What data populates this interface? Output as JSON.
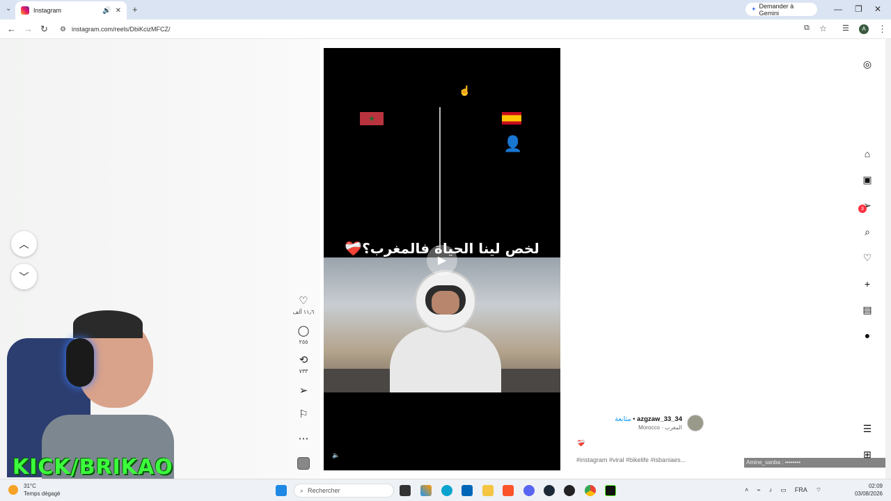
{
  "browser": {
    "tab_title": "Instagram",
    "tab_audio_icon": "speaker-icon",
    "tab_close": "✕",
    "new_tab": "+",
    "gemini_label": "Demander à Gemini",
    "url": "instagram.com/reels/DbiKcizMFCZ/",
    "window_controls": [
      "—",
      "❐",
      "✕"
    ]
  },
  "left": {
    "prev_label": "︿",
    "next_label": "﹀",
    "webcam_overlay_text": "KICK/BRIKAO"
  },
  "actions": {
    "like_count": "١١٫٦ ألف",
    "comment_count": "٢٥٥",
    "repost_count": "٧٣٣"
  },
  "video": {
    "caption": "لخص لينا الحياة فالمغرب؟❤️‍🩹",
    "play_icon": "▶",
    "mute_icon": "🔈"
  },
  "post": {
    "follow_label": "متابعة",
    "separator": "•",
    "username": "azgzaw_33_34",
    "location": "Morocco · المغرب",
    "description_emoji": "❤️‍🩹",
    "hashtags": "#instagram #viral #bikelife #isbaniaes..."
  },
  "nav": {
    "notification_count": "3"
  },
  "overlay_text": "Amine_sanba : ••••••••",
  "taskbar": {
    "temperature": "31°C",
    "weather": "Temps dégagé",
    "search_placeholder": "Rechercher",
    "language": "FRA",
    "time": "02:09",
    "date": "03/08/2026"
  },
  "colors": {
    "accent_blue": "#0095f6",
    "badge_red": "#ff3040",
    "kick_green": "#3cff3c"
  }
}
